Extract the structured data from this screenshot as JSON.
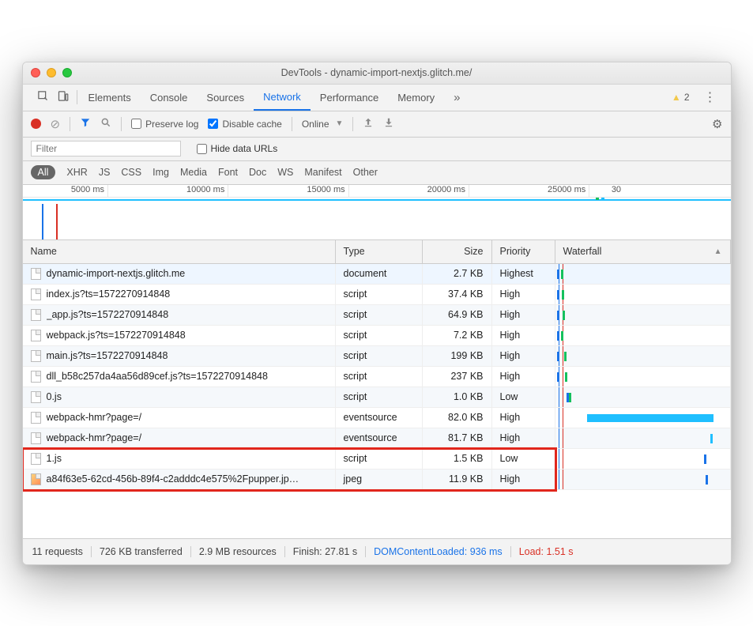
{
  "window": {
    "title": "DevTools - dynamic-import-nextjs.glitch.me/"
  },
  "tabs": {
    "items": [
      "Elements",
      "Console",
      "Sources",
      "Network",
      "Performance",
      "Memory"
    ],
    "activeIndex": 3,
    "warnCount": "2"
  },
  "toolbar": {
    "preserveLog": "Preserve log",
    "disableCache": "Disable cache",
    "online": "Online"
  },
  "filterbar": {
    "placeholder": "Filter",
    "hideData": "Hide data URLs"
  },
  "typeChips": [
    "All",
    "XHR",
    "JS",
    "CSS",
    "Img",
    "Media",
    "Font",
    "Doc",
    "WS",
    "Manifest",
    "Other"
  ],
  "timelineTicks": [
    "5000 ms",
    "10000 ms",
    "15000 ms",
    "20000 ms",
    "25000 ms",
    "30"
  ],
  "table": {
    "headers": {
      "name": "Name",
      "type": "Type",
      "size": "Size",
      "priority": "Priority",
      "waterfall": "Waterfall"
    },
    "rows": [
      {
        "name": "dynamic-import-nextjs.glitch.me",
        "type": "document",
        "size": "2.7 KB",
        "priority": "Highest",
        "icon": "doc",
        "hi": true,
        "wf": {
          "ticks": [
            {
              "l": 2,
              "c": "#1a73e8"
            },
            {
              "l": 7,
              "c": "#15c15d"
            }
          ]
        }
      },
      {
        "name": "index.js?ts=1572270914848",
        "type": "script",
        "size": "37.4 KB",
        "priority": "High",
        "icon": "doc",
        "wf": {
          "ticks": [
            {
              "l": 2,
              "c": "#1a73e8"
            },
            {
              "l": 8,
              "c": "#15c15d"
            }
          ]
        }
      },
      {
        "name": "_app.js?ts=1572270914848",
        "type": "script",
        "size": "64.9 KB",
        "priority": "High",
        "icon": "doc",
        "alt": true,
        "wf": {
          "ticks": [
            {
              "l": 2,
              "c": "#1a73e8"
            },
            {
              "l": 9,
              "c": "#15c15d"
            }
          ]
        }
      },
      {
        "name": "webpack.js?ts=1572270914848",
        "type": "script",
        "size": "7.2 KB",
        "priority": "High",
        "icon": "doc",
        "wf": {
          "ticks": [
            {
              "l": 2,
              "c": "#1a73e8"
            },
            {
              "l": 7,
              "c": "#15c15d"
            }
          ]
        }
      },
      {
        "name": "main.js?ts=1572270914848",
        "type": "script",
        "size": "199 KB",
        "priority": "High",
        "icon": "doc",
        "alt": true,
        "wf": {
          "ticks": [
            {
              "l": 2,
              "c": "#1a73e8"
            },
            {
              "l": 11,
              "c": "#15c15d"
            }
          ]
        }
      },
      {
        "name": "dll_b58c257da4aa56d89cef.js?ts=1572270914848",
        "type": "script",
        "size": "237 KB",
        "priority": "High",
        "icon": "doc",
        "wf": {
          "ticks": [
            {
              "l": 2,
              "c": "#1a73e8"
            },
            {
              "l": 12,
              "c": "#15c15d"
            }
          ]
        }
      },
      {
        "name": "0.js",
        "type": "script",
        "size": "1.0 KB",
        "priority": "Low",
        "icon": "doc",
        "alt": true,
        "wf": {
          "ticks": [
            {
              "l": 14,
              "c": "#1a73e8"
            },
            {
              "l": 17,
              "c": "#15c15d"
            }
          ]
        }
      },
      {
        "name": "webpack-hmr?page=/",
        "type": "eventsource",
        "size": "82.0 KB",
        "priority": "High",
        "icon": "doc",
        "wf": {
          "bar": {
            "l": 40,
            "w": 160
          }
        }
      },
      {
        "name": "webpack-hmr?page=/",
        "type": "eventsource",
        "size": "81.7 KB",
        "priority": "High",
        "icon": "doc",
        "alt": true,
        "wf": {
          "ticks": [
            {
              "l": 196,
              "c": "#1fbfff"
            }
          ]
        }
      },
      {
        "name": "1.js",
        "type": "script",
        "size": "1.5 KB",
        "priority": "Low",
        "icon": "doc",
        "boxed": true,
        "wf": {
          "ticks": [
            {
              "l": 188,
              "c": "#1a73e8"
            }
          ]
        }
      },
      {
        "name": "a84f63e5-62cd-456b-89f4-c2adddc4e575%2Fpupper.jp…",
        "type": "jpeg",
        "size": "11.9 KB",
        "priority": "High",
        "icon": "img",
        "boxed": true,
        "alt": true,
        "wf": {
          "ticks": [
            {
              "l": 190,
              "c": "#1a73e8"
            }
          ]
        }
      }
    ]
  },
  "status": {
    "requests": "11 requests",
    "transferred": "726 KB transferred",
    "resources": "2.9 MB resources",
    "finish": "Finish: 27.81 s",
    "dcl": "DOMContentLoaded: 936 ms",
    "load": "Load: 1.51 s"
  }
}
